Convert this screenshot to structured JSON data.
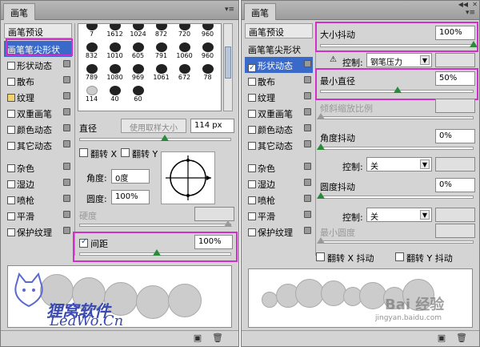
{
  "left_panel": {
    "tab_title": "画笔",
    "presets_button": "画笔预设",
    "sidebar": [
      {
        "label": "画笔笔尖形状",
        "type": "tip"
      },
      {
        "label": "形状动态",
        "checked": false
      },
      {
        "label": "散布",
        "checked": false
      },
      {
        "label": "纹理",
        "checked": false
      },
      {
        "label": "双重画笔",
        "checked": false
      },
      {
        "label": "颜色动态",
        "checked": false
      },
      {
        "label": "其它动态",
        "checked": false
      },
      {
        "label": "杂色",
        "checked": false
      },
      {
        "label": "湿边",
        "checked": false
      },
      {
        "label": "喷枪",
        "checked": false
      },
      {
        "label": "平滑",
        "checked": false
      },
      {
        "label": "保护纹理",
        "checked": false
      }
    ],
    "brush_sizes": [
      "7",
      "1612",
      "1024",
      "872",
      "720",
      "960",
      "832",
      "1010",
      "605",
      "791",
      "1060",
      "960",
      "789",
      "1080",
      "969",
      "1061",
      "672",
      "78",
      "114",
      "40",
      "60"
    ],
    "diameter_label": "直径",
    "use_sample_size": "使用取样大小",
    "diameter_value": "114 px",
    "flip_x": "翻转 X",
    "flip_y": "翻转 Y",
    "angle_label": "角度:",
    "angle_value": "0度",
    "roundness_label": "圆度:",
    "roundness_value": "100%",
    "hardness_label": "硬度",
    "spacing_label": "间距",
    "spacing_value": "100%"
  },
  "right_panel": {
    "tab_title": "画笔",
    "presets_button": "画笔预设",
    "sidebar": [
      {
        "label": "画笔笔尖形状",
        "type": "tip"
      },
      {
        "label": "形状动态",
        "checked": true
      },
      {
        "label": "散布",
        "checked": false
      },
      {
        "label": "纹理",
        "checked": false
      },
      {
        "label": "双重画笔",
        "checked": false
      },
      {
        "label": "颜色动态",
        "checked": false
      },
      {
        "label": "其它动态",
        "checked": false
      },
      {
        "label": "杂色",
        "checked": false
      },
      {
        "label": "湿边",
        "checked": false
      },
      {
        "label": "喷枪",
        "checked": false
      },
      {
        "label": "平滑",
        "checked": false
      },
      {
        "label": "保护纹理",
        "checked": false
      }
    ],
    "size_jitter_label": "大小抖动",
    "size_jitter_value": "100%",
    "control_label": "控制:",
    "control_value_pen": "钢笔压力",
    "min_diameter_label": "最小直径",
    "min_diameter_value": "50%",
    "tilt_scale_label": "倾斜缩放比例",
    "angle_jitter_label": "角度抖动",
    "angle_jitter_value": "0%",
    "control_off_1": "关",
    "roundness_jitter_label": "圆度抖动",
    "roundness_jitter_value": "0%",
    "control_off_2": "关",
    "min_roundness_label": "最小圆度",
    "flip_x_jitter": "翻转 X 抖动",
    "flip_y_jitter": "翻转 Y 抖动"
  },
  "watermarks": {
    "left_cn": "狸窝软件",
    "left_en": "LeaWo.Cn",
    "right_brand": "Bai 经验",
    "right_url": "jingyan.baidu.com"
  },
  "colors": {
    "panel_bg": "#d4d4d4",
    "selection_blue": "#3969c9",
    "highlight_magenta": "#d030c8",
    "slider_knob": "#2a8a3a"
  }
}
